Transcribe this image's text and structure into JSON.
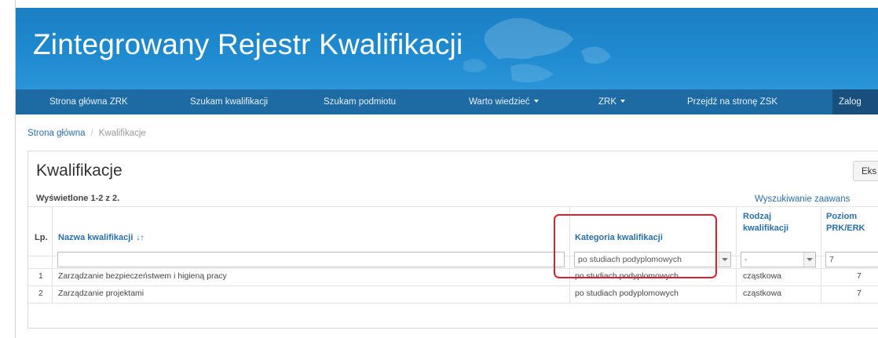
{
  "header": {
    "title": "Zintegrowany Rejestr Kwalifikacji"
  },
  "nav": {
    "items": [
      {
        "label": "Strona główna ZRK"
      },
      {
        "label": "Szukam kwalifikacji"
      },
      {
        "label": "Szukam podmiotu"
      },
      {
        "label": "Warto wiedzieć"
      },
      {
        "label": "ZRK"
      },
      {
        "label": "Przejdź na stronę ZSK"
      },
      {
        "label": "Zalog"
      }
    ]
  },
  "breadcrumb": {
    "home": "Strona główna",
    "separator": "/",
    "current": "Kwalifikacje"
  },
  "panel": {
    "title": "Kwalifikacje",
    "export_label": "Eks",
    "shown_text": "Wyświetlone 1-2 z 2.",
    "advanced_search": "Wyszukiwanie zaawans"
  },
  "table": {
    "headers": {
      "lp": "Lp.",
      "name": "Nazwa kwalifikacji",
      "category": "Kategoria kwalifikacji",
      "type_line1": "Rodzaj",
      "type_line2": "kwalifikacji",
      "level_line1": "Poziom",
      "level_line2": "PRK/ERK"
    },
    "filters": {
      "name": "",
      "category": "po studiach podyplomowych",
      "type": "-",
      "level": "7"
    },
    "rows": [
      {
        "lp": "1",
        "name": "Zarządzanie bezpieczeństwem i higieną pracy",
        "category": "po studiach podyplomowych",
        "type": "cząstkowa",
        "level": "7"
      },
      {
        "lp": "2",
        "name": "Zarządzanie projektami",
        "category": "po studiach podyplomowych",
        "type": "cząstkowa",
        "level": "7"
      }
    ]
  },
  "colors": {
    "banner": "#1f8ad0",
    "navbar": "#1e6aa3",
    "link": "#2a6fa8",
    "highlight": "#d4232d"
  }
}
